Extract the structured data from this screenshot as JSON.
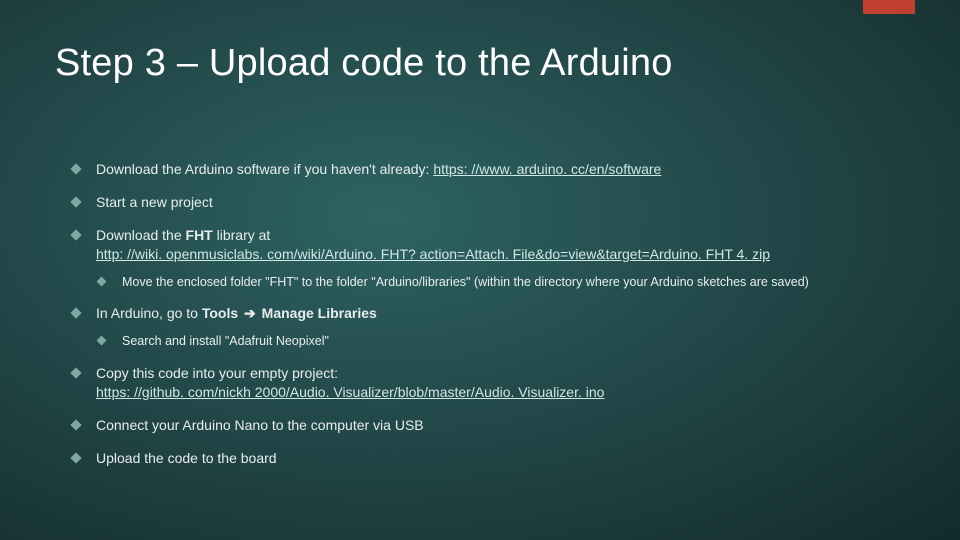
{
  "accent_color": "#c13f2e",
  "title": "Step 3 – Upload code to the Arduino",
  "items": {
    "i0_pre": "Download the Arduino software if you haven't already: ",
    "i0_link": "https: //www. arduino. cc/en/software",
    "i1": "Start a new project",
    "i2_pre": "Download the ",
    "i2_bold": "FHT",
    "i2_post": " library at ",
    "i2_link": "http: //wiki. openmusiclabs. com/wiki/Arduino. FHT? action=Attach. File&do=view&target=Arduino. FHT 4. zip",
    "i2_sub0": "Move the enclosed folder \"FHT\" to the folder \"Arduino/libraries\" (within the directory where your Arduino sketches are saved)",
    "i3_pre": "In Arduino, go to ",
    "i3_b1": "Tools",
    "i3_arrow": "➔",
    "i3_b2": "Manage Libraries",
    "i3_sub0": "Search and install \"Adafruit Neopixel\"",
    "i4_pre": "Copy this code into your empty project: ",
    "i4_link": "https: //github. com/nickh 2000/Audio. Visualizer/blob/master/Audio. Visualizer. ino",
    "i5": "Connect your Arduino Nano to the computer via USB",
    "i6": "Upload the code to the board"
  }
}
